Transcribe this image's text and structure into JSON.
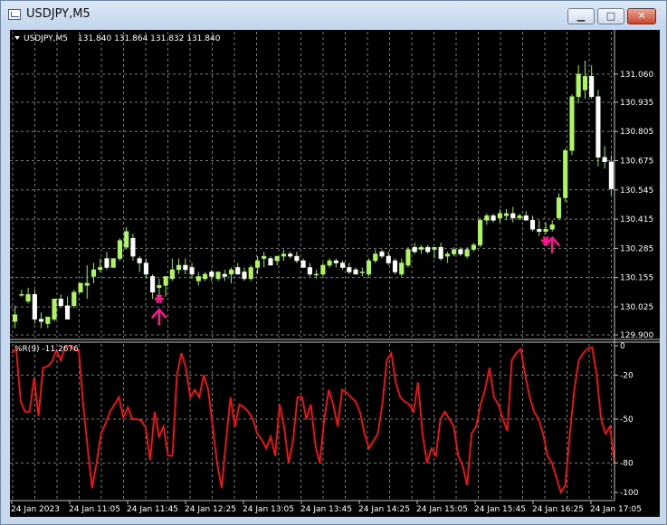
{
  "window": {
    "title": "USDJPY,M5",
    "minimize_glyph": "▁",
    "maximize_glyph": "□",
    "close_glyph": "✕"
  },
  "colors": {
    "background": "#000000",
    "grid": "#7a7a7a",
    "bull": "#aef55f",
    "bear": "#ffffff",
    "wick": "#8ef03a",
    "indicator_line": "#ff1010",
    "signal": "#ff1493",
    "axis_text": "#ffffff"
  },
  "icons": [
    "dropdown-triangle-icon",
    "arrow-up-icon",
    "asterisk-icon"
  ],
  "chart_data": [
    {
      "type": "candlestick",
      "title": "USDJPY,M5",
      "quote": "131.840 131.864 131.832 131.840",
      "y_ticks": [
        "131.060",
        "130.935",
        "130.805",
        "130.675",
        "130.545",
        "130.415",
        "130.285",
        "130.155",
        "130.025",
        "129.900"
      ],
      "ylim": [
        129.9,
        131.12
      ],
      "grid": true,
      "candles": [
        [
          129.96,
          130.03,
          129.93,
          129.99
        ],
        [
          130.08,
          130.1,
          130.07,
          130.08
        ],
        [
          130.05,
          130.11,
          130.04,
          130.08
        ],
        [
          130.08,
          130.1,
          129.95,
          129.97
        ],
        [
          129.97,
          130.0,
          129.93,
          129.96
        ],
        [
          129.95,
          129.98,
          129.93,
          129.98
        ],
        [
          129.97,
          130.06,
          129.96,
          130.06
        ],
        [
          130.06,
          130.08,
          130.02,
          130.03
        ],
        [
          130.03,
          130.07,
          129.97,
          129.97
        ],
        [
          130.03,
          130.1,
          130.02,
          130.09
        ],
        [
          130.09,
          130.13,
          130.09,
          130.13
        ],
        [
          130.12,
          130.21,
          130.06,
          130.13
        ],
        [
          130.16,
          130.22,
          130.13,
          130.19
        ],
        [
          130.19,
          130.24,
          130.18,
          130.2
        ],
        [
          130.24,
          130.27,
          130.19,
          130.2
        ],
        [
          130.2,
          130.24,
          130.2,
          130.24
        ],
        [
          130.24,
          130.33,
          130.23,
          130.32
        ],
        [
          130.29,
          130.38,
          130.28,
          130.36
        ],
        [
          130.33,
          130.35,
          130.23,
          130.25
        ],
        [
          130.24,
          130.25,
          130.18,
          130.22
        ],
        [
          130.22,
          130.24,
          130.15,
          130.17
        ],
        [
          130.16,
          130.17,
          130.06,
          130.09
        ],
        [
          130.11,
          130.15,
          130.07,
          130.12
        ],
        [
          130.12,
          130.16,
          130.07,
          130.16
        ],
        [
          130.15,
          130.24,
          130.14,
          130.19
        ],
        [
          130.19,
          130.24,
          130.17,
          130.21
        ],
        [
          130.21,
          130.24,
          130.17,
          130.19
        ],
        [
          130.2,
          130.22,
          130.15,
          130.17
        ],
        [
          130.14,
          130.18,
          130.12,
          130.16
        ],
        [
          130.15,
          130.18,
          130.14,
          130.17
        ],
        [
          130.18,
          130.19,
          130.14,
          130.16
        ],
        [
          130.15,
          130.18,
          130.14,
          130.18
        ],
        [
          130.17,
          130.19,
          130.14,
          130.16
        ],
        [
          130.17,
          130.2,
          130.13,
          130.19
        ],
        [
          130.2,
          130.22,
          130.17,
          130.17
        ],
        [
          130.18,
          130.2,
          130.14,
          130.15
        ],
        [
          130.15,
          130.21,
          130.14,
          130.2
        ],
        [
          130.2,
          130.25,
          130.17,
          130.23
        ],
        [
          130.24,
          130.27,
          130.2,
          130.25
        ],
        [
          130.24,
          130.25,
          130.21,
          130.21
        ],
        [
          130.23,
          130.25,
          130.21,
          130.25
        ],
        [
          130.25,
          130.28,
          130.23,
          130.26
        ],
        [
          130.26,
          130.27,
          130.24,
          130.25
        ],
        [
          130.25,
          130.27,
          130.22,
          130.23
        ],
        [
          130.23,
          130.24,
          130.2,
          130.2
        ],
        [
          130.2,
          130.22,
          130.16,
          130.17
        ],
        [
          130.17,
          130.19,
          130.15,
          130.17
        ],
        [
          130.17,
          130.22,
          130.16,
          130.21
        ],
        [
          130.21,
          130.24,
          130.2,
          130.23
        ],
        [
          130.23,
          130.24,
          130.2,
          130.22
        ],
        [
          130.22,
          130.23,
          130.19,
          130.2
        ],
        [
          130.2,
          130.22,
          130.17,
          130.18
        ],
        [
          130.19,
          130.2,
          130.17,
          130.17
        ],
        [
          130.18,
          130.2,
          130.16,
          130.18
        ],
        [
          130.17,
          130.24,
          130.16,
          130.23
        ],
        [
          130.23,
          130.28,
          130.22,
          130.26
        ],
        [
          130.27,
          130.28,
          130.24,
          130.25
        ],
        [
          130.25,
          130.27,
          130.21,
          130.22
        ],
        [
          130.23,
          130.24,
          130.17,
          130.18
        ],
        [
          130.17,
          130.24,
          130.16,
          130.22
        ],
        [
          130.21,
          130.29,
          130.2,
          130.28
        ],
        [
          130.29,
          130.31,
          130.26,
          130.27
        ],
        [
          130.28,
          130.3,
          130.26,
          130.29
        ],
        [
          130.29,
          130.3,
          130.26,
          130.27
        ],
        [
          130.28,
          130.29,
          130.24,
          130.29
        ],
        [
          130.29,
          130.31,
          130.23,
          130.24
        ],
        [
          130.25,
          130.27,
          130.22,
          130.26
        ],
        [
          130.26,
          130.29,
          130.25,
          130.28
        ],
        [
          130.28,
          130.29,
          130.25,
          130.26
        ],
        [
          130.25,
          130.29,
          130.24,
          130.28
        ],
        [
          130.28,
          130.31,
          130.27,
          130.3
        ],
        [
          130.3,
          130.42,
          130.29,
          130.41
        ],
        [
          130.41,
          130.44,
          130.39,
          130.43
        ],
        [
          130.43,
          130.44,
          130.4,
          130.41
        ],
        [
          130.42,
          130.46,
          130.4,
          130.44
        ],
        [
          130.43,
          130.46,
          130.41,
          130.44
        ],
        [
          130.44,
          130.47,
          130.4,
          130.42
        ],
        [
          130.42,
          130.44,
          130.41,
          130.43
        ],
        [
          130.43,
          130.45,
          130.41,
          130.41
        ],
        [
          130.41,
          130.43,
          130.36,
          130.37
        ],
        [
          130.37,
          130.41,
          130.34,
          130.36
        ],
        [
          130.36,
          130.4,
          130.35,
          130.37
        ],
        [
          130.37,
          130.41,
          130.36,
          130.39
        ],
        [
          130.42,
          130.53,
          130.41,
          130.51
        ],
        [
          130.51,
          130.73,
          130.49,
          130.72
        ],
        [
          130.72,
          130.97,
          130.7,
          130.96
        ],
        [
          130.96,
          131.1,
          130.93,
          131.06
        ],
        [
          130.99,
          131.12,
          130.95,
          131.05
        ],
        [
          131.05,
          131.1,
          130.95,
          130.96
        ],
        [
          130.96,
          130.99,
          130.65,
          130.69
        ],
        [
          130.69,
          130.74,
          130.64,
          130.67
        ],
        [
          130.67,
          130.7,
          130.52,
          130.55
        ]
      ],
      "signals": [
        {
          "index": 22,
          "price": 130.0,
          "icon": "arrow-up-icon"
        },
        {
          "index": 22,
          "price": 130.06,
          "icon": "asterisk-icon"
        },
        {
          "index": 82,
          "price": 130.32,
          "icon": "arrow-up-icon"
        },
        {
          "index": 81,
          "price": 130.32,
          "icon": "asterisk-icon"
        }
      ]
    },
    {
      "type": "line",
      "title": "%R(9) -11.2676",
      "y_ticks": [
        "0",
        "-20",
        "-50",
        "-80",
        "-100"
      ],
      "ylim": [
        -100,
        0
      ],
      "grid": true,
      "values": [
        -5,
        -2,
        -38,
        -45,
        -45,
        -22,
        -48,
        -15,
        -14,
        -11,
        -3,
        -10,
        0,
        0,
        -3,
        -3,
        -40,
        -70,
        -97,
        -80,
        -60,
        -53,
        -45,
        -40,
        -35,
        -49,
        -42,
        -50,
        -50,
        -51,
        -56,
        -78,
        -45,
        -62,
        -55,
        -75,
        -75,
        -20,
        -5,
        -15,
        -35,
        -30,
        -35,
        -20,
        -30,
        -55,
        -80,
        -97,
        -65,
        -35,
        -55,
        -40,
        -42,
        -45,
        -50,
        -60,
        -64,
        -70,
        -62,
        -75,
        -40,
        -55,
        -80,
        -65,
        -35,
        -35,
        -50,
        -40,
        -68,
        -80,
        -50,
        -30,
        -40,
        -55,
        -30,
        -32,
        -35,
        -38,
        -45,
        -60,
        -70,
        -65,
        -60,
        -40,
        -10,
        -5,
        -25,
        -35,
        -38,
        -40,
        -45,
        -25,
        -60,
        -80,
        -70,
        -75,
        -50,
        -45,
        -50,
        -55,
        -75,
        -82,
        -95,
        -60,
        -55,
        -40,
        -30,
        -15,
        -35,
        -40,
        -50,
        -58,
        -10,
        -5,
        -2,
        -20,
        -35,
        -45,
        -50,
        -60,
        -75,
        -80,
        -90,
        -100,
        -95,
        -60,
        -30,
        -10,
        -5,
        -2,
        -1,
        -20,
        -50,
        -60,
        -55,
        -80
      ]
    }
  ],
  "time_axis": [
    "24 Jan 2023",
    "24 Jan 11:05",
    "24 Jan 11:45",
    "24 Jan 12:25",
    "24 Jan 13:05",
    "24 Jan 13:45",
    "24 Jan 14:25",
    "24 Jan 15:05",
    "24 Jan 15:45",
    "24 Jan 16:25",
    "24 Jan 17:05"
  ]
}
